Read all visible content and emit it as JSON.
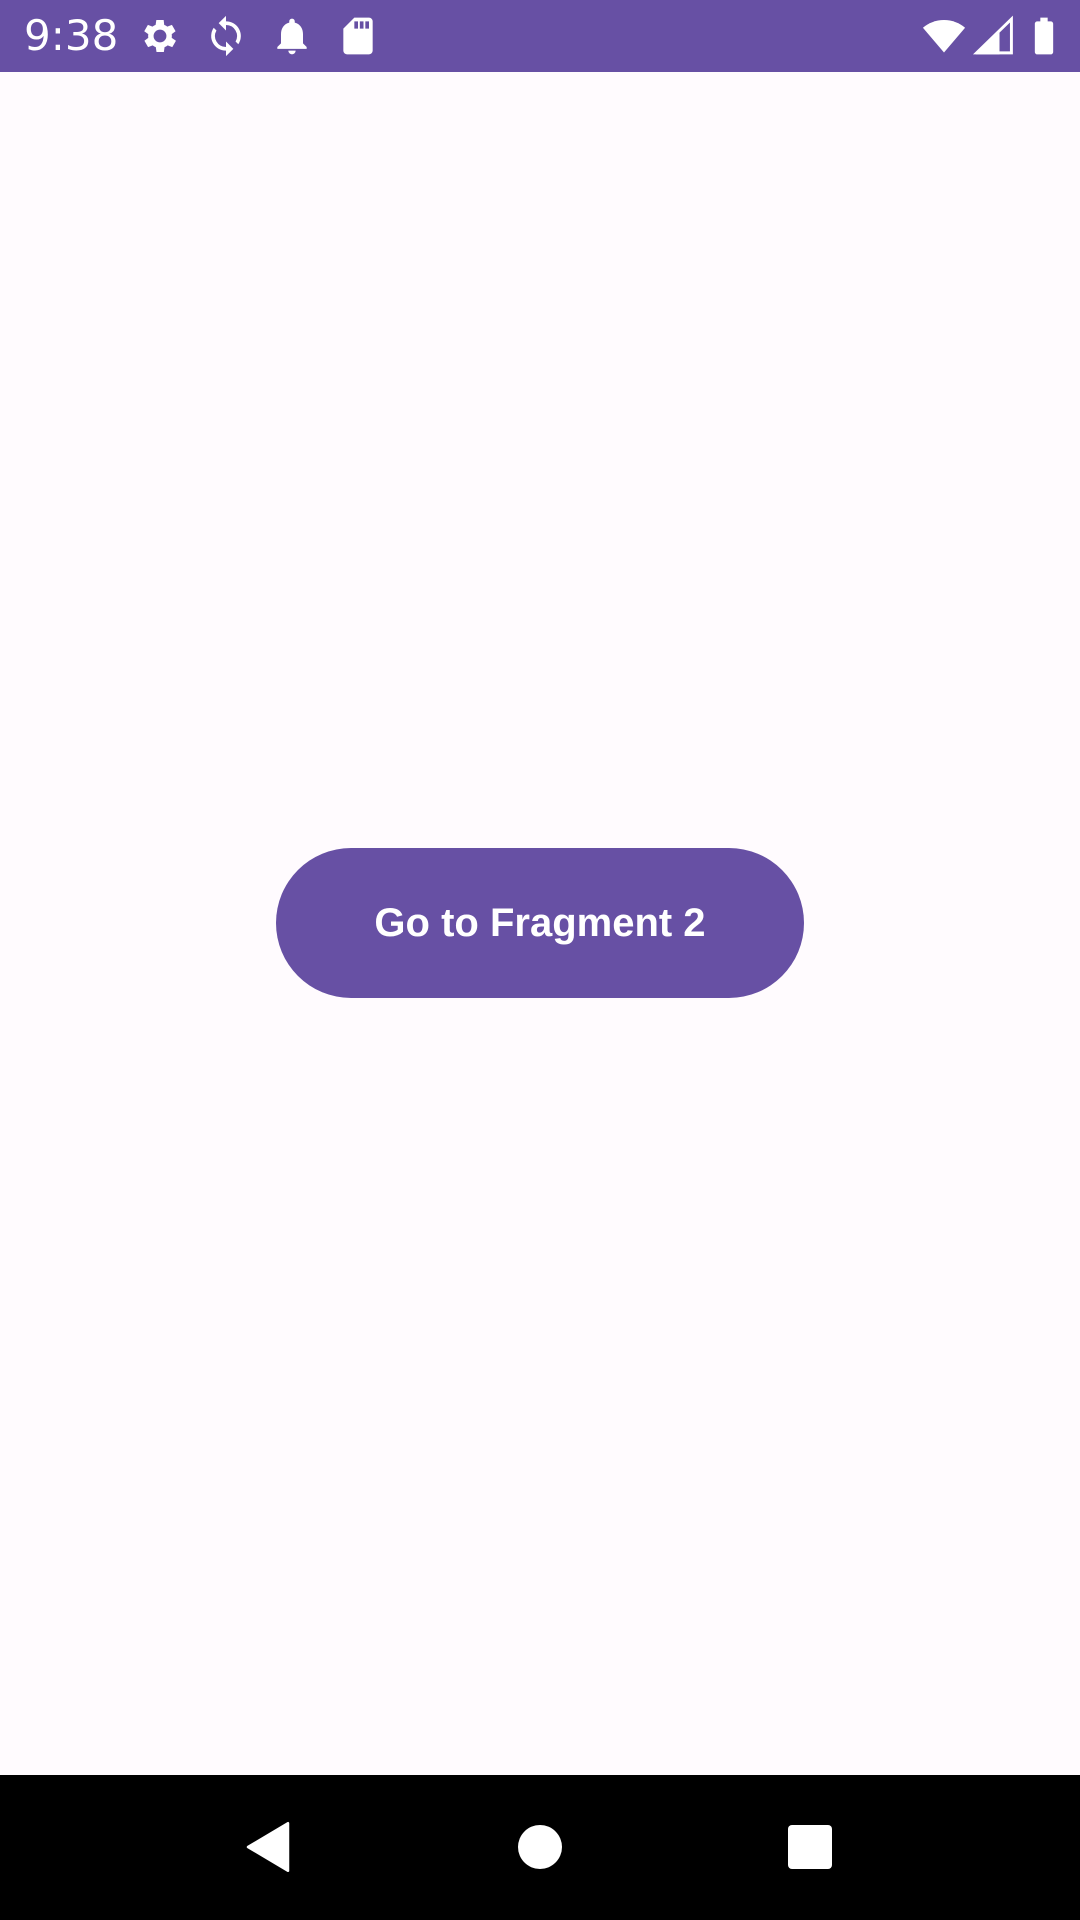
{
  "status_bar": {
    "time": "9:38",
    "background_color": "#6750a4",
    "left_icons": [
      "settings-icon",
      "sync-icon",
      "notification-bell-icon",
      "sd-card-icon"
    ],
    "right_icons": [
      "wifi-icon",
      "cellular-signal-icon",
      "battery-icon"
    ]
  },
  "main": {
    "background_color": "#fffbfe",
    "button": {
      "label": "Go to Fragment 2",
      "color": "#6750a4"
    }
  },
  "navigation_bar": {
    "background_color": "#000000",
    "buttons": [
      "back-icon",
      "home-icon",
      "recents-icon"
    ]
  }
}
